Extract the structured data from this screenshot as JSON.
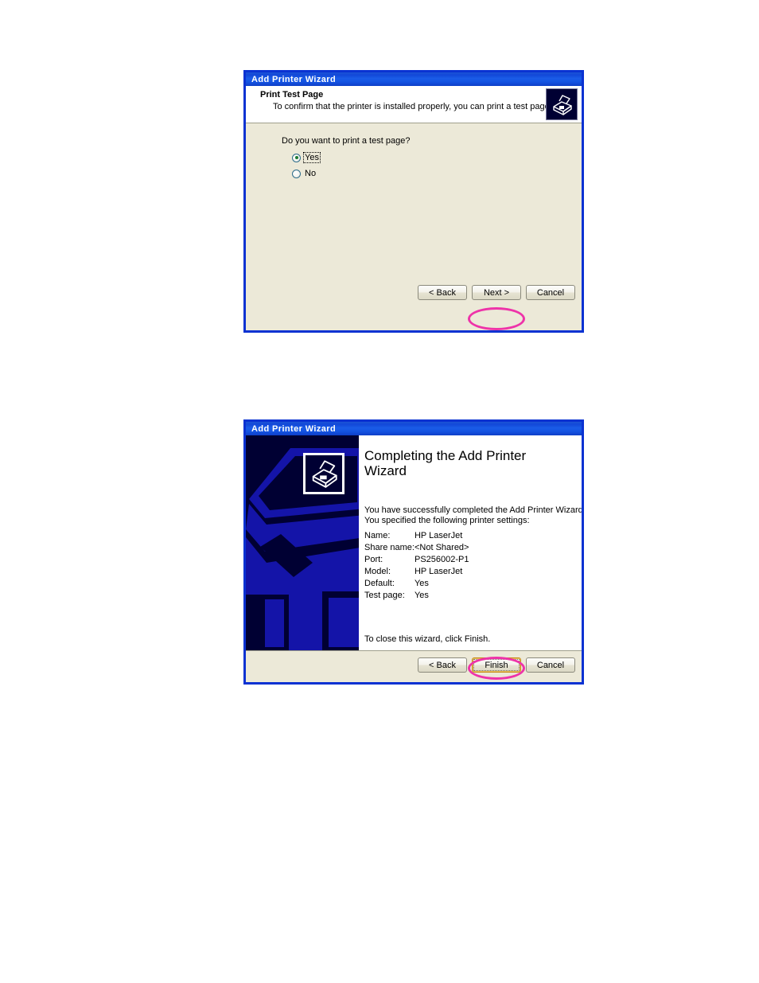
{
  "page": {
    "background": "#ffffff",
    "title_bar_color": "#1248d8",
    "dialog_face_color": "#ece9d8",
    "highlight_color": "#ee33a9"
  },
  "dialog1": {
    "window_title": "Add Printer Wizard",
    "header": {
      "title": "Print Test Page",
      "subtitle": "To confirm that the printer is installed properly, you can print a test page.",
      "icon": "printer-icon"
    },
    "question": "Do you want to print a test page?",
    "options": [
      {
        "label": "Yes",
        "accel": "Y",
        "selected": true,
        "focused": true
      },
      {
        "label": "No",
        "accel": "o",
        "selected": false,
        "focused": false
      }
    ],
    "buttons": [
      {
        "label": "< Back",
        "accel": "B",
        "name": "back-button",
        "default": false,
        "highlighted": false
      },
      {
        "label": "Next >",
        "accel": "N",
        "name": "next-button",
        "default": false,
        "highlighted": true
      },
      {
        "label": "Cancel",
        "accel": "",
        "name": "cancel-button",
        "default": false,
        "highlighted": false
      }
    ]
  },
  "dialog2": {
    "window_title": "Add Printer Wizard",
    "side_panel": {
      "icon": "printer-icon",
      "graphic": "printer-outline-graphic"
    },
    "title": "Completing the Add Printer Wizard",
    "lead_line_1": "You have successfully completed the Add Printer Wizard",
    "lead_line_2": "You specified the following printer settings:",
    "settings": [
      {
        "key": "Name:",
        "value": "HP LaserJet"
      },
      {
        "key": "Share name:",
        "value": "<Not Shared>"
      },
      {
        "key": "Port:",
        "value": "PS256002-P1"
      },
      {
        "key": "Model:",
        "value": "HP LaserJet"
      },
      {
        "key": "Default:",
        "value": "Yes"
      },
      {
        "key": "Test page:",
        "value": "Yes"
      }
    ],
    "closing_line": "To close this wizard, click Finish.",
    "buttons": [
      {
        "label": "< Back",
        "accel": "B",
        "name": "back-button",
        "default": false,
        "highlighted": false
      },
      {
        "label": "Finish",
        "accel": "",
        "name": "finish-button",
        "default": true,
        "highlighted": true
      },
      {
        "label": "Cancel",
        "accel": "",
        "name": "cancel-button",
        "default": false,
        "highlighted": false
      }
    ]
  }
}
